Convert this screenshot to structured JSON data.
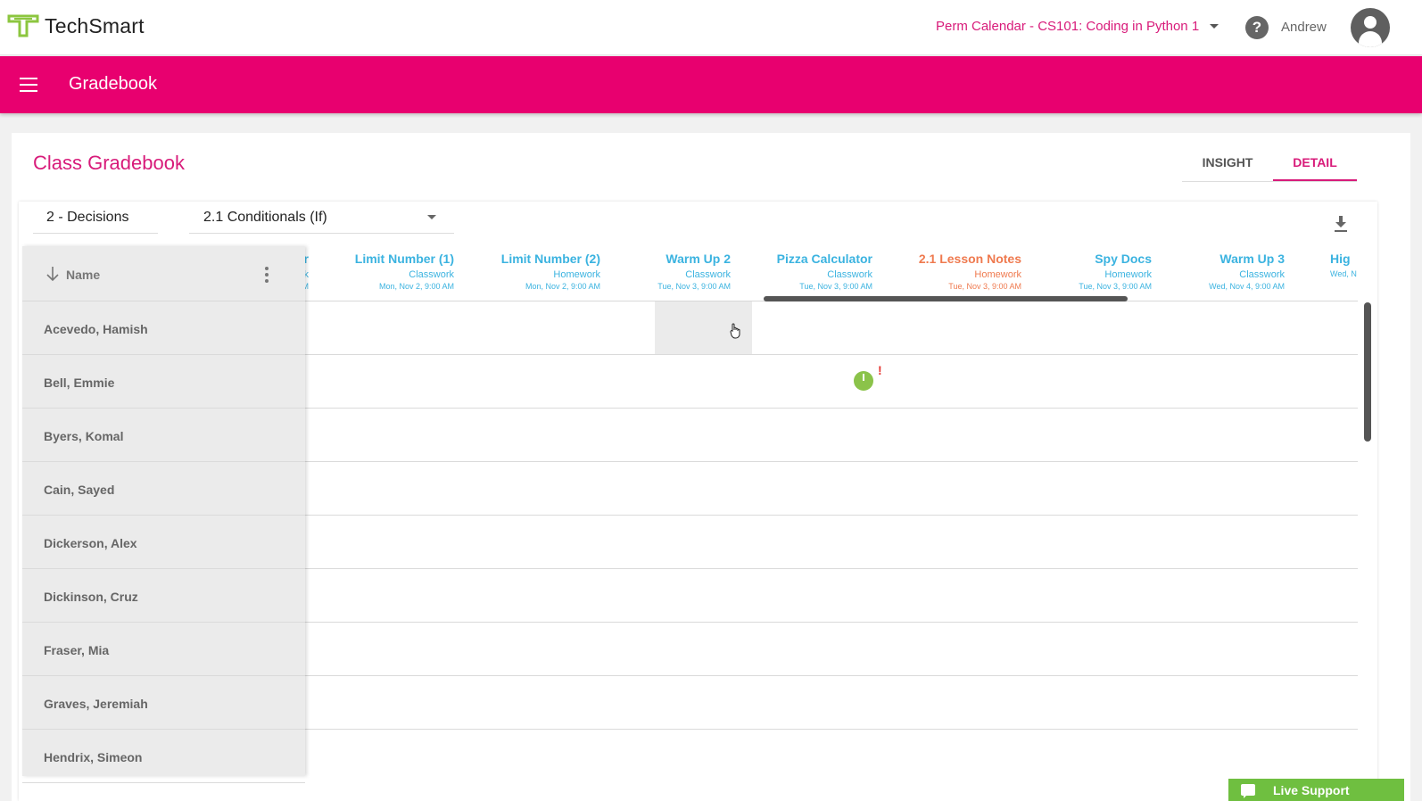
{
  "topbar": {
    "logo_text": "TechSmart",
    "calendar_label": "Perm Calendar - CS101: Coding in Python 1",
    "user_name": "Andrew",
    "help_symbol": "?"
  },
  "appbar": {
    "title": "Gradebook"
  },
  "page": {
    "title": "Class Gradebook",
    "tabs": [
      {
        "label": "INSIGHT",
        "active": false
      },
      {
        "label": "DETAIL",
        "active": true
      }
    ]
  },
  "filters": {
    "unit": "2 - Decisions",
    "lesson": "2.1 Conditionals (If)"
  },
  "name_column": {
    "header": "Name"
  },
  "students": [
    "Acevedo, Hamish",
    "Bell, Emmie",
    "Byers, Komal",
    "Cain, Sayed",
    "Dickerson, Alex",
    "Dickinson, Cruz",
    "Fraser, Mia",
    "Graves, Jeremiah",
    "Hendrix, Simeon"
  ],
  "assignments": [
    {
      "title": "r",
      "kind": "k",
      "date": "M",
      "color": "#3bb3e0"
    },
    {
      "title": "Limit Number (1)",
      "kind": "Classwork",
      "date": "Mon, Nov 2, 9:00 AM",
      "color": "#3bb3e0"
    },
    {
      "title": "Limit Number (2)",
      "kind": "Homework",
      "date": "Mon, Nov 2, 9:00 AM",
      "color": "#3bb3e0"
    },
    {
      "title": "Warm Up 2",
      "kind": "Classwork",
      "date": "Tue, Nov 3, 9:00 AM",
      "color": "#3bb3e0"
    },
    {
      "title": "Pizza Calculator",
      "kind": "Classwork",
      "date": "Tue, Nov 3, 9:00 AM",
      "color": "#3bb3e0"
    },
    {
      "title": "2.1 Lesson Notes",
      "kind": "Homework",
      "date": "Tue, Nov 3, 9:00 AM",
      "color": "#ef7a4f"
    },
    {
      "title": "Spy Docs",
      "kind": "Homework",
      "date": "Tue, Nov 3, 9:00 AM",
      "color": "#3bb3e0"
    },
    {
      "title": "Warm Up 3",
      "kind": "Classwork",
      "date": "Wed, Nov 4, 9:00 AM",
      "color": "#3bb3e0"
    },
    {
      "title": "Hig",
      "kind": "",
      "date": "Wed, N",
      "color": "#3bb3e0"
    }
  ],
  "cells": {
    "bell_pizza_calculator": {
      "icon": "progress-clock-icon",
      "alert": "!"
    }
  },
  "live_support": {
    "label": "Live Support"
  }
}
